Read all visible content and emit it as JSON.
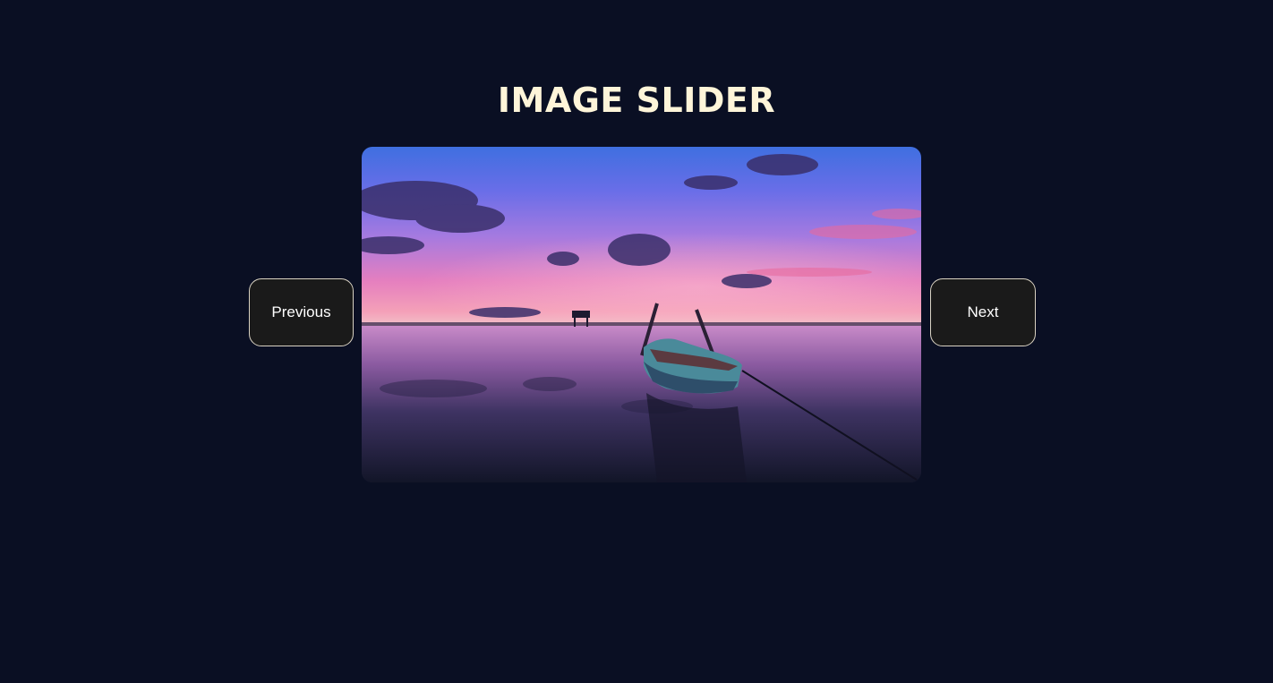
{
  "page": {
    "title": "IMAGE SLIDER"
  },
  "slider": {
    "image_icon": "sunset-boat-image",
    "prev_label": "Previous",
    "next_label": "Next"
  },
  "colors": {
    "background": "#0a0f23",
    "title": "#fff5d9",
    "button_bg": "#1a1a1a",
    "button_border": "#d9d2c2",
    "button_text": "#ffffff"
  }
}
